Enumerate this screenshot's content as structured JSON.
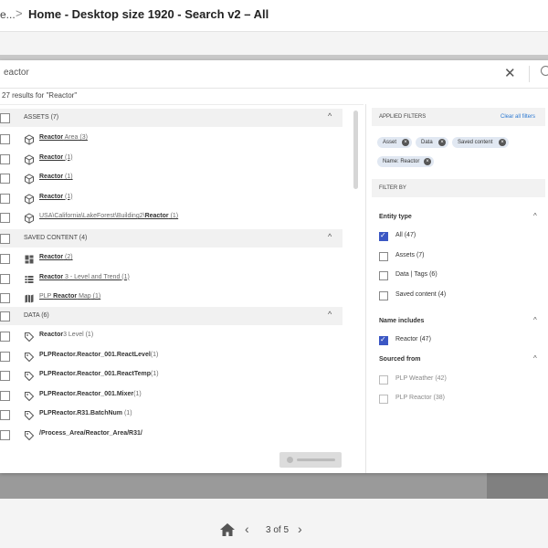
{
  "header": {
    "crumb_prev": "e...",
    "separator": ">",
    "title": "Home - Desktop size 1920 - Search v2 – All"
  },
  "search": {
    "value": "Reactor",
    "visible_value": "eactor",
    "clear_icon": "✕"
  },
  "results_text": "27 results for \"Reactor\"",
  "groups": {
    "assets": {
      "label": "ASSETS (7)",
      "caret": "^"
    },
    "saved": {
      "label": "SAVED CONTENT (4)",
      "caret": "^"
    },
    "data": {
      "label": "DATA (6)",
      "caret": "^"
    }
  },
  "asset_rows": [
    {
      "pre": "",
      "match": "Reactor",
      "post": " Area",
      "count": " (3)",
      "icon": "cube-icon"
    },
    {
      "pre": "",
      "match": "Reactor",
      "post": "",
      "count": " (1)",
      "icon": "cube-icon"
    },
    {
      "pre": "",
      "match": "Reactor",
      "post": "",
      "count": " (1)",
      "icon": "cube-icon"
    },
    {
      "pre": "",
      "match": "Reactor",
      "post": "",
      "count": " (1)",
      "icon": "cube-icon"
    },
    {
      "pre": "USA\\California\\LakeForest\\Building2\\",
      "match": "Reactor",
      "post": "",
      "count": " (1)",
      "icon": "cube-icon"
    }
  ],
  "saved_rows": [
    {
      "pre": "",
      "match": "Reactor",
      "post": "",
      "count": " (2)",
      "icon": "dashboard-icon"
    },
    {
      "pre": "",
      "match": "Reactor",
      "post": " 3 - Level and Trend",
      "count": " (1)",
      "icon": "list-icon"
    },
    {
      "pre": "PLP ",
      "match": "Reactor",
      "post": " Map",
      "count": " (1)",
      "icon": "map-icon"
    }
  ],
  "data_rows": [
    {
      "pre": "",
      "match": "Reactor",
      "post": "3 Level",
      "count": " (1)",
      "icon": "tag-icon"
    },
    {
      "pre": "",
      "match": "PLPReactor.Reactor_001.ReactLevel",
      "post": "",
      "count": "(1)",
      "icon": "tag-icon"
    },
    {
      "pre": "",
      "match": "PLPReactor.Reactor_001.ReactTemp",
      "post": "",
      "count": "(1)",
      "icon": "tag-icon"
    },
    {
      "pre": "",
      "match": "PLPReactor.Reactor_001.Mixer",
      "post": "",
      "count": "(1)",
      "icon": "tag-icon"
    },
    {
      "pre": "",
      "match": "PLPReactor.R31.BatchNum",
      "post": "",
      "count": " (1)",
      "icon": "tag-icon"
    },
    {
      "pre": "",
      "match": "/Process_Area/Reactor_Area/R31/",
      "post": "",
      "count": "",
      "icon": "tag-icon"
    }
  ],
  "filters": {
    "applied_title": "APPLIED FILTERS",
    "clear_all": "Clear all filters",
    "chips": [
      "Asset",
      "Data",
      "Saved content",
      "Name: Reactor"
    ],
    "filter_by": "FILTER BY",
    "entity_type": {
      "title": "Entity type",
      "options": [
        "All (47)",
        "Assets (7)",
        "Data | Tags (6)",
        "Saved content (4)"
      ]
    },
    "name_includes": {
      "title": "Name includes",
      "options": [
        "Reactor (47)"
      ]
    },
    "sourced_from": {
      "title": "Sourced from",
      "options": [
        "PLP Weather (42)",
        "PLP Reactor (38)"
      ]
    }
  },
  "pagination": {
    "text": "3 of 5",
    "prev": "‹",
    "next": "›"
  },
  "colors": {
    "accent": "#3b57c4",
    "link": "#2b78d1",
    "chip_bg": "#e1e8f2"
  }
}
